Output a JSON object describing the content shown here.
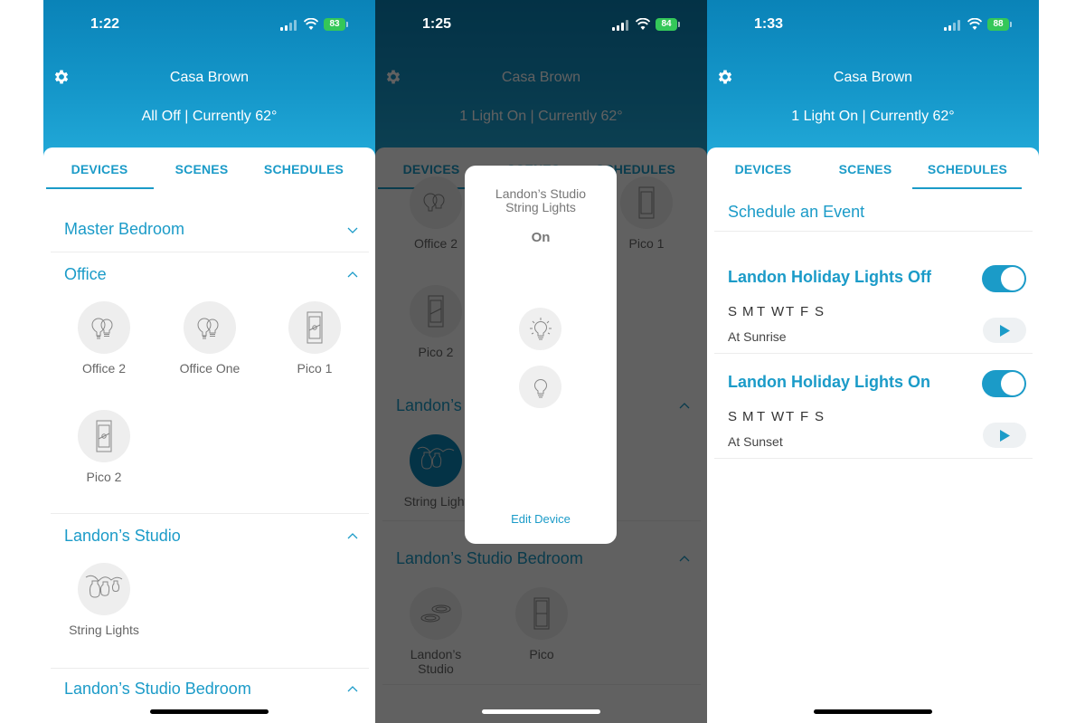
{
  "brand_color": "#1b9bc8",
  "screens": [
    {
      "status": {
        "time": "1:22",
        "battery": "83"
      },
      "header": {
        "home_name": "Casa Brown",
        "home_status": "All Off | Currently 62°"
      },
      "tabs": [
        "DEVICES",
        "SCENES",
        "SCHEDULES"
      ],
      "active_tab": "DEVICES",
      "rooms": [
        {
          "name": "Master Bedroom",
          "expanded": false,
          "devices": []
        },
        {
          "name": "Office",
          "expanded": true,
          "devices": [
            {
              "label": "Office 2",
              "icon": "dual-bulb-icon"
            },
            {
              "label": "Office One",
              "icon": "dual-bulb-icon"
            },
            {
              "label": "Pico 1",
              "icon": "pico-remote-icon"
            },
            {
              "label": "Pico 2",
              "icon": "pico-remote-icon"
            }
          ]
        },
        {
          "name": "Landon’s Studio",
          "expanded": true,
          "devices": [
            {
              "label": "String Lights",
              "icon": "string-lights-icon"
            }
          ]
        },
        {
          "name": "Landon’s Studio Bedroom",
          "expanded": true,
          "devices": []
        }
      ]
    },
    {
      "status": {
        "time": "1:25",
        "battery": "84"
      },
      "header": {
        "home_name": "Casa Brown",
        "home_status": "1 Light On | Currently 62°"
      },
      "tabs": [
        "DEVICES",
        "SCENES",
        "SCHEDULES"
      ],
      "active_tab": "DEVICES",
      "background_devices": {
        "office": [
          "Office 2",
          "Pico 1",
          "Pico 2"
        ],
        "landons_studio_title": "Landon’s",
        "string_lights_label": "String Light",
        "studio_bedroom_title": "Landon’s Studio Bedroom",
        "studio_bedroom_devices": [
          "Landon’s Studio",
          "Pico"
        ]
      },
      "modal": {
        "title": "Landon’s Studio String Lights",
        "state": "On",
        "on_button": "light-on-icon",
        "off_button": "light-off-icon",
        "edit_label": "Edit Device"
      }
    },
    {
      "status": {
        "time": "1:33",
        "battery": "88"
      },
      "header": {
        "home_name": "Casa Brown",
        "home_status": "1 Light On | Currently 62°"
      },
      "tabs": [
        "DEVICES",
        "SCENES",
        "SCHEDULES"
      ],
      "active_tab": "SCHEDULES",
      "schedule_link": "Schedule an Event",
      "schedules": [
        {
          "name": "Landon Holiday Lights Off",
          "days": [
            "S",
            "M",
            "T",
            "W",
            "T",
            "F",
            "S"
          ],
          "when": "At Sunrise",
          "enabled": true
        },
        {
          "name": "Landon Holiday Lights On",
          "days": [
            "S",
            "M",
            "T",
            "W",
            "T",
            "F",
            "S"
          ],
          "when": "At Sunset",
          "enabled": true
        }
      ]
    }
  ]
}
